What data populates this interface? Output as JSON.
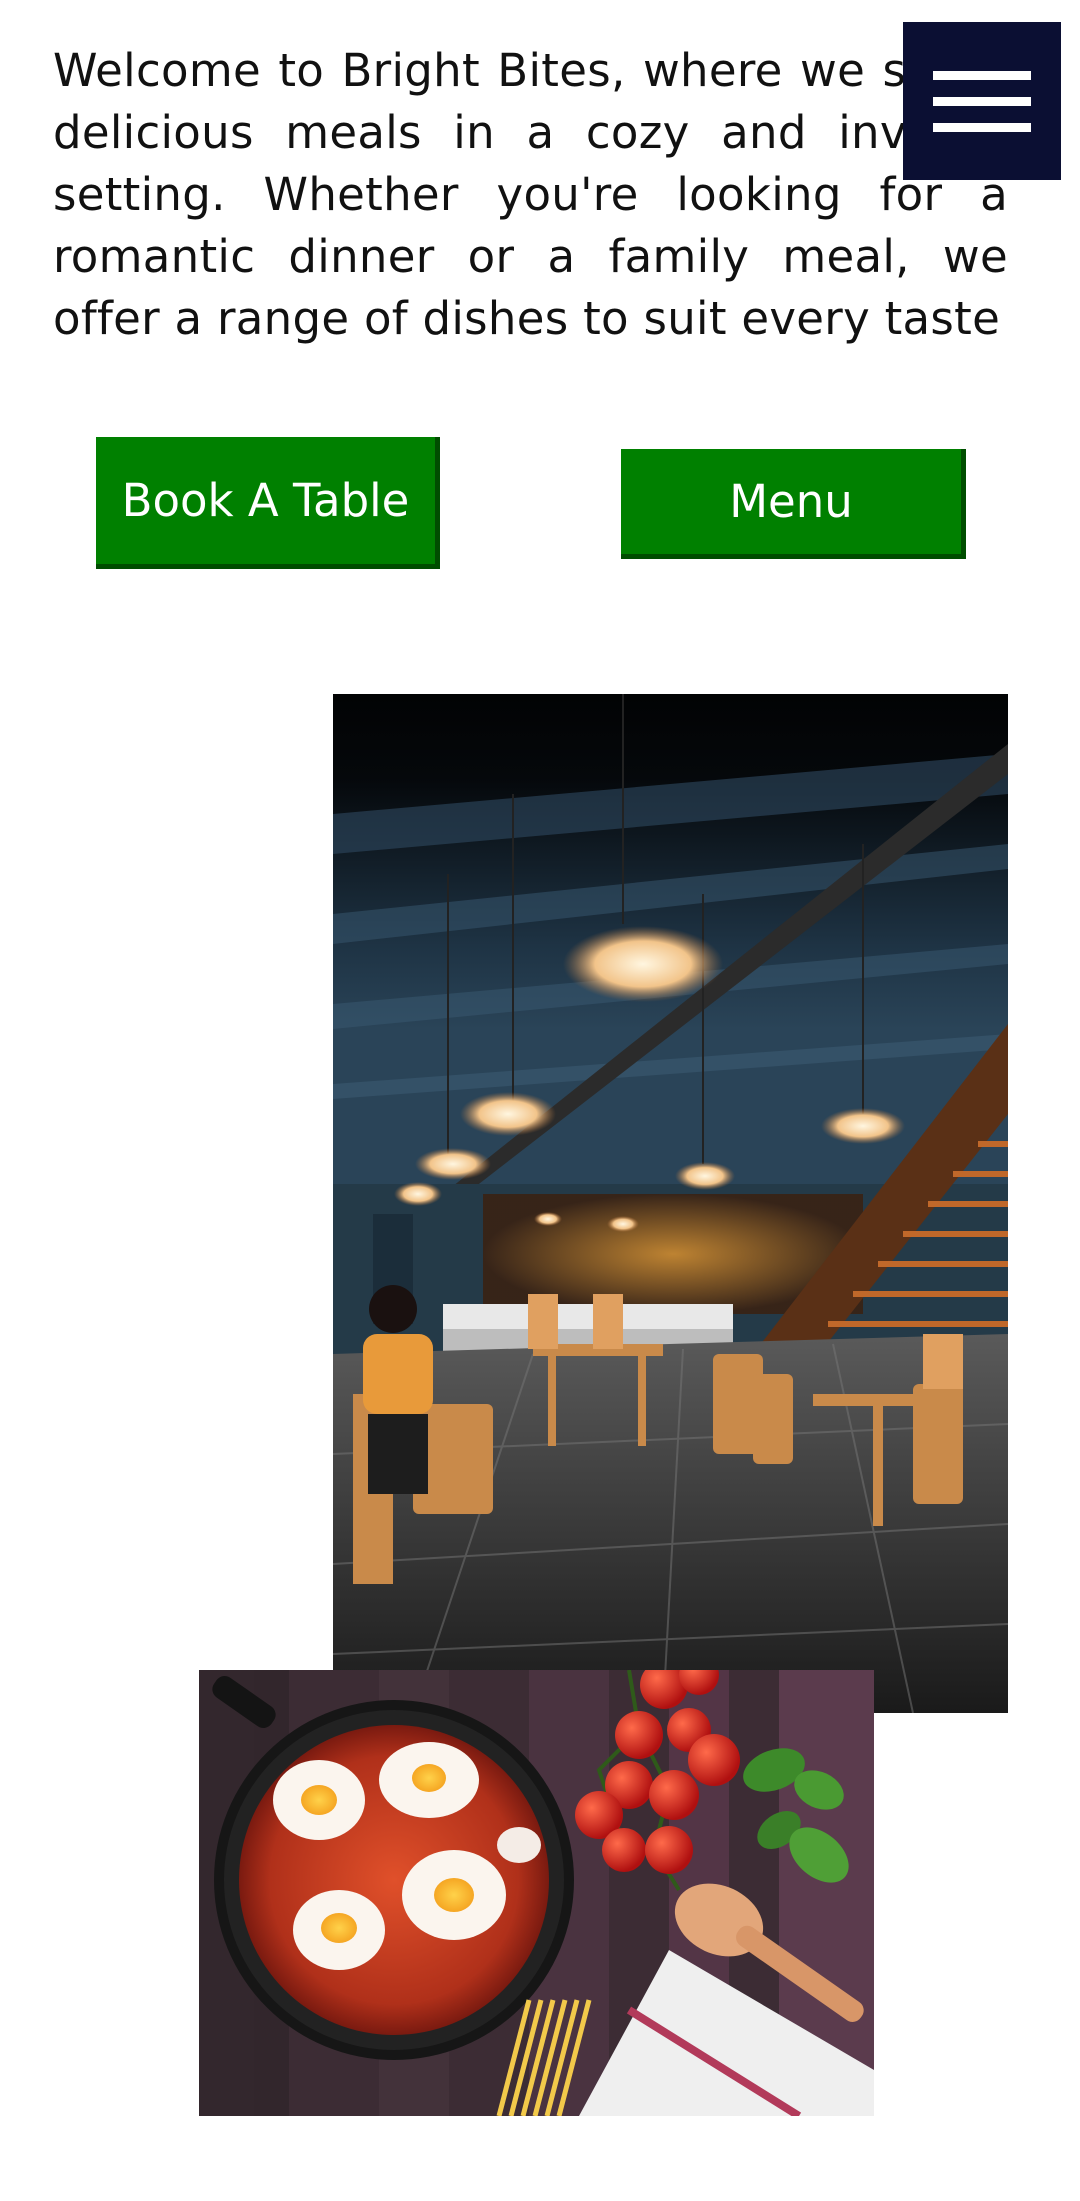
{
  "intro": {
    "text": "Welcome to Bright Bites, where we serve delicious meals in a cozy and inviting setting. Whether you're looking for a romantic dinner or a family meal, we offer a range of dishes to suit every taste"
  },
  "nav": {
    "menu_icon": "hamburger-icon",
    "menu_icon_bg": "#0b0f33"
  },
  "actions": {
    "book_label": "Book A Table",
    "menu_label": "Menu",
    "button_color": "#008000"
  },
  "gallery": {
    "images": [
      {
        "subject": "restaurant-interior"
      },
      {
        "subject": "shakshuka-dish"
      }
    ]
  }
}
